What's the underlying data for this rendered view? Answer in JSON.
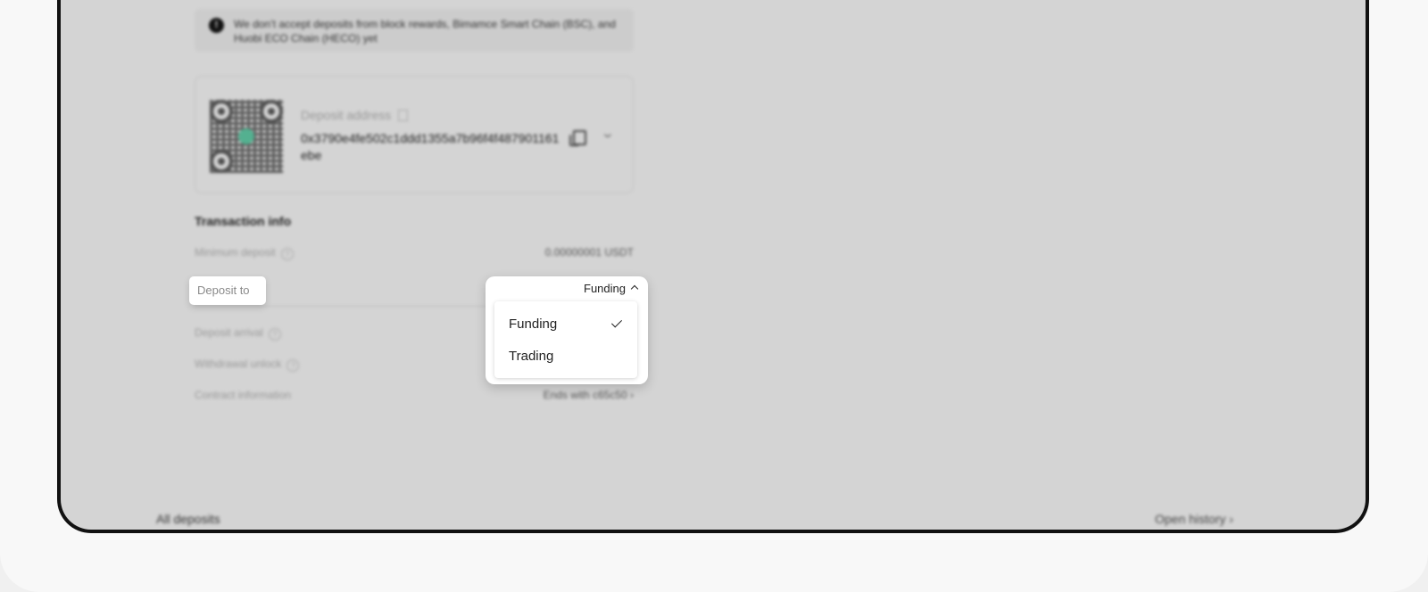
{
  "notice": {
    "text": "We don’t accept deposits from block rewards, Bimamce Smart Chain (BSC), and Huobi ECO Chain (HECO) yet"
  },
  "deposit_address": {
    "label": "Deposit address",
    "value": "0x3790e4fe502c1ddd1355a7b96f4f487901161ebe"
  },
  "transaction_info": {
    "title": "Transaction info",
    "minimum_deposit_label": "Minimum deposit",
    "minimum_deposit_value": "0.00000001 USDT",
    "deposit_to_label": "Deposit to",
    "deposit_arrival_label": "Deposit arrival",
    "withdrawal_unlock_label": "Withdrawal unlock",
    "contract_information_label": "Contract information",
    "contract_information_value": "Ends with c65c50"
  },
  "dropdown": {
    "selected": "Funding",
    "options": [
      {
        "label": "Funding",
        "checked": true
      },
      {
        "label": "Trading",
        "checked": false
      }
    ]
  },
  "footer": {
    "all_deposits": "All deposits",
    "open_history": "Open history"
  }
}
